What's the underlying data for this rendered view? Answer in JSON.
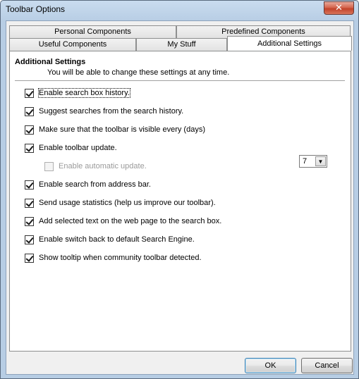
{
  "window": {
    "title": "Toolbar Options",
    "close_glyph": "✕"
  },
  "tabs": {
    "row_back": [
      {
        "label": "Personal Components"
      },
      {
        "label": "Predefined Components"
      }
    ],
    "row_front": [
      {
        "label": "Useful Components"
      },
      {
        "label": "My Stuff"
      },
      {
        "label": "Additional Settings",
        "active": true
      }
    ]
  },
  "panel": {
    "title": "Additional Settings",
    "description": "You will be able to change these settings at any time.",
    "options": [
      {
        "label": "Enable search box history.",
        "checked": true
      },
      {
        "label": "Suggest searches from the search history.",
        "checked": true
      },
      {
        "label": "Make sure that the toolbar is visible every (days)",
        "checked": true
      },
      {
        "label": "Enable toolbar update.",
        "checked": true
      },
      {
        "label": "Enable automatic update.",
        "checked": false,
        "disabled": true
      },
      {
        "label": "Enable search from address bar.",
        "checked": true
      },
      {
        "label": "Send usage statistics (help us improve our toolbar).",
        "checked": true
      },
      {
        "label": "Add selected text on the web page to the search box.",
        "checked": true
      },
      {
        "label": "Enable switch back to default Search Engine.",
        "checked": true
      },
      {
        "label": "Show tooltip when community toolbar detected.",
        "checked": true
      }
    ],
    "days_dropdown": {
      "value": "7",
      "arrow": "▼"
    }
  },
  "buttons": {
    "ok": "OK",
    "cancel": "Cancel"
  }
}
